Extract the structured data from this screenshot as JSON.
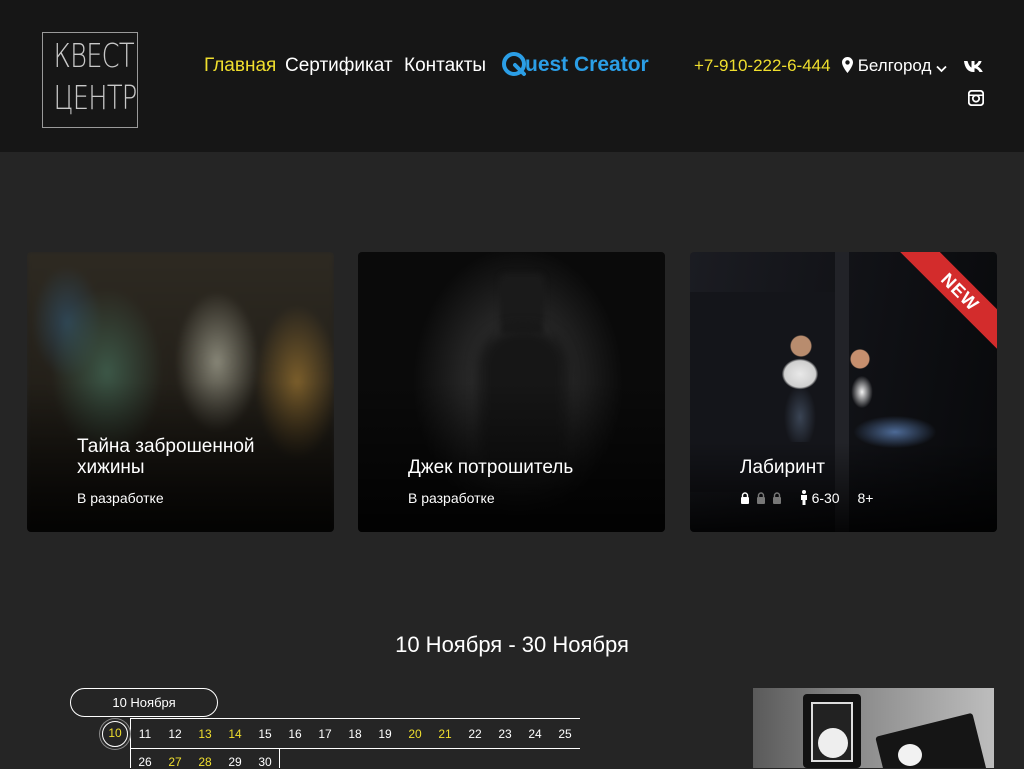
{
  "header": {
    "logo": {
      "line1": "КВЕСТ",
      "line2": "ЦЕНТР"
    },
    "nav": [
      {
        "label": "Главная",
        "active": true
      },
      {
        "label": "Сертификат",
        "active": false
      },
      {
        "label": "Контакты",
        "active": false
      }
    ],
    "quest_creator": {
      "q": "Q",
      "label": "uest Creator"
    },
    "phone": "+7-910-222-6-444",
    "city": "Белгород",
    "social": [
      "vk-icon",
      "instagram-icon"
    ]
  },
  "colors": {
    "accent": "#f0df2e",
    "brand_blue": "#2b9ee6",
    "badge_red": "#d32c2c",
    "header_bg": "#161616",
    "page_bg": "#252525"
  },
  "quests": [
    {
      "title": "Тайна заброшенной хижины",
      "status": "В разработке"
    },
    {
      "title": "Джек потрошитель",
      "status": "В разработке"
    },
    {
      "title": "Лабиринт",
      "badge": "NEW",
      "difficulty": "1 of 3",
      "players": "6-30",
      "age": "8+"
    }
  ],
  "schedule": {
    "range": "10 Ноября - 30 Ноября",
    "month_label": "10 Ноября",
    "row1": [
      {
        "d": "10",
        "today": true,
        "weekend": true
      },
      {
        "d": "11"
      },
      {
        "d": "12"
      },
      {
        "d": "13",
        "weekend": true
      },
      {
        "d": "14",
        "weekend": true
      },
      {
        "d": "15"
      },
      {
        "d": "16"
      },
      {
        "d": "17"
      },
      {
        "d": "18"
      },
      {
        "d": "19"
      },
      {
        "d": "20",
        "weekend": true
      },
      {
        "d": "21",
        "weekend": true
      },
      {
        "d": "22"
      },
      {
        "d": "23"
      },
      {
        "d": "24"
      },
      {
        "d": "25"
      }
    ],
    "row2": [
      {
        "d": "26"
      },
      {
        "d": "27",
        "weekend": true
      },
      {
        "d": "28",
        "weekend": true
      },
      {
        "d": "29"
      },
      {
        "d": "30"
      }
    ]
  }
}
